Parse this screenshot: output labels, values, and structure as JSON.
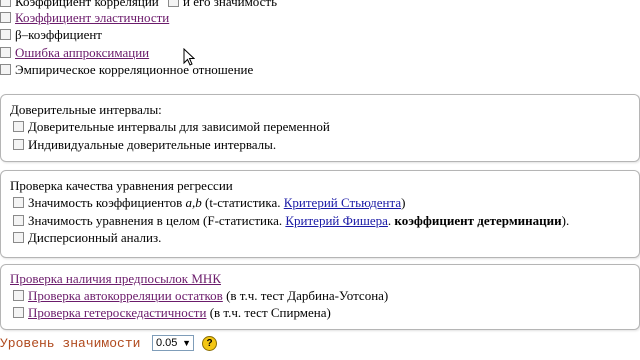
{
  "top_section": {
    "items": [
      {
        "label": "Коэффициент корреляции",
        "extra": "и его значимость"
      },
      {
        "label": "Коэффициент эластичности"
      },
      {
        "label": "β–коэффициент"
      },
      {
        "label": "Ошибка аппроксимации"
      },
      {
        "label": "Эмпирическое корреляционное отношение"
      }
    ]
  },
  "confidence": {
    "title": "Доверительные интервалы:",
    "items": [
      "Доверительные интервалы для зависимой переменной",
      "Индивидуальные доверительные интервалы."
    ]
  },
  "quality": {
    "title": "Проверка качества уравнения регрессии",
    "item1": {
      "prefix": "Значимость коэффициентов ",
      "vars": "a,b",
      "middle": " (t-статистика. ",
      "link": "Критерий Стьюдента",
      "suffix": ")"
    },
    "item2": {
      "prefix": "Значимость уравнения в целом (F-статистика. ",
      "link": "Критерий Фишера",
      "middle": ". ",
      "bold": "коэффициент детерминации",
      "suffix": ")."
    },
    "item3": "Дисперсионный анализ."
  },
  "mnk": {
    "title": "Проверка наличия предпосылок МНК",
    "item1": {
      "link": "Проверка автокорреляции остатков",
      "suffix": " (в т.ч. тест Дарбина-Уотсона)"
    },
    "item2": {
      "link": "Проверка гетероскедастичности",
      "suffix": " (в т.ч. тест Спирмена)"
    }
  },
  "significance": {
    "label": "Уровень значимости",
    "value": "0.05",
    "arrow": "▼",
    "help": "?"
  }
}
